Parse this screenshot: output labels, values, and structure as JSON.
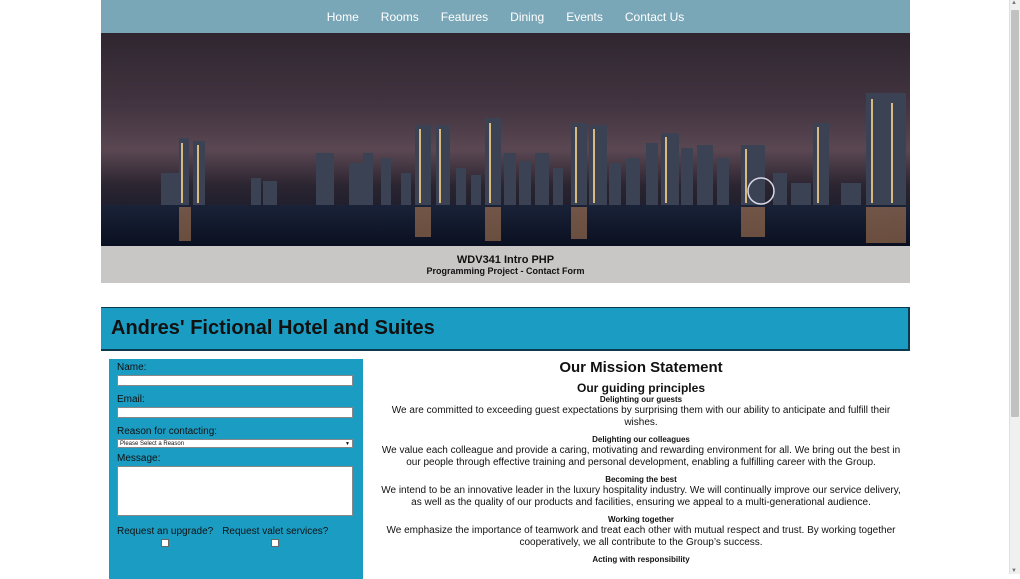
{
  "nav": {
    "items": [
      "Home",
      "Rooms",
      "Features",
      "Dining",
      "Events",
      "Contact Us"
    ]
  },
  "caption": {
    "title": "WDV341 Intro PHP",
    "subtitle": "Programming Project - Contact Form"
  },
  "banner": {
    "title": "Andres' Fictional Hotel and Suites"
  },
  "form": {
    "name_label": "Name:",
    "email_label": "Email:",
    "reason_label": "Reason for contacting:",
    "reason_selected": "Please Select a Reason",
    "message_label": "Message:",
    "upgrade_label": "Request an upgrade?",
    "valet_label": "Request valet services?"
  },
  "mission": {
    "title": "Our Mission Statement",
    "subtitle": "Our guiding principles",
    "principles": [
      {
        "heading": "Delighting our guests",
        "text": "We are committed to exceeding guest expectations by surprising them with our ability to anticipate and fulfill their wishes."
      },
      {
        "heading": "Delighting our colleagues",
        "text": "We value each colleague and provide a caring, motivating and rewarding environment for all. We bring out the best in our people through effective training and personal development, enabling a fulfilling career with the Group."
      },
      {
        "heading": "Becoming the best",
        "text": "We intend to be an innovative leader in the luxury hospitality industry. We will continually improve our service delivery, as well as the quality of our products and facilities, ensuring we appeal to a multi-generational audience."
      },
      {
        "heading": "Working together",
        "text": "We emphasize the importance of teamwork and treat each other with mutual respect and trust. By working together cooperatively, we all contribute to the Group’s success."
      },
      {
        "heading": "Acting with responsibility",
        "text": ""
      }
    ]
  }
}
